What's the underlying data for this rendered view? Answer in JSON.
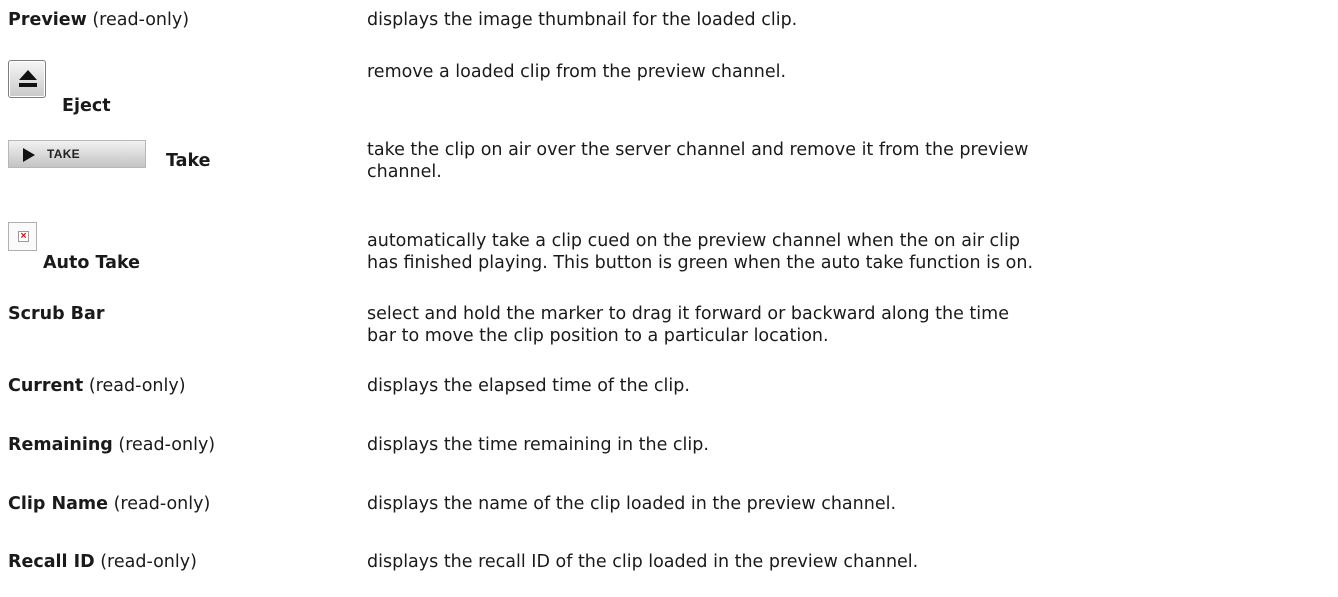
{
  "rows": [
    {
      "term": "Preview",
      "qualifier": " (read-only)",
      "desc": "displays the image thumbnail for the loaded clip."
    },
    {
      "term": "Eject",
      "desc": "remove a loaded clip from the preview channel."
    },
    {
      "term": "Take",
      "button_label": "TAKE",
      "desc_lines": [
        "take the clip on air over the server channel and remove it from the preview",
        "channel."
      ]
    },
    {
      "term": "Auto Take",
      "desc_lines": [
        "automatically take a clip cued on the preview channel when the on air clip",
        "has finished playing. This button is green when the auto take function is on."
      ]
    },
    {
      "term": "Scrub Bar",
      "desc_lines": [
        "select and hold the marker to drag it forward or backward along the time",
        "bar to move the clip position to a particular location."
      ]
    },
    {
      "term": "Current",
      "qualifier": " (read-only)",
      "desc": "displays the elapsed time of the clip."
    },
    {
      "term": "Remaining",
      "qualifier": " (read-only)",
      "desc": "displays the time remaining in the clip."
    },
    {
      "term": "Clip Name",
      "qualifier": " (read-only)",
      "desc": "displays the name of the clip loaded in the preview channel."
    },
    {
      "term": "Recall ID",
      "qualifier": " (read-only)",
      "desc": "displays the recall ID of the clip loaded in the preview channel."
    }
  ],
  "icons": {
    "eject": "eject-icon",
    "take": "play-icon",
    "auto_take": "broken-image-icon"
  }
}
